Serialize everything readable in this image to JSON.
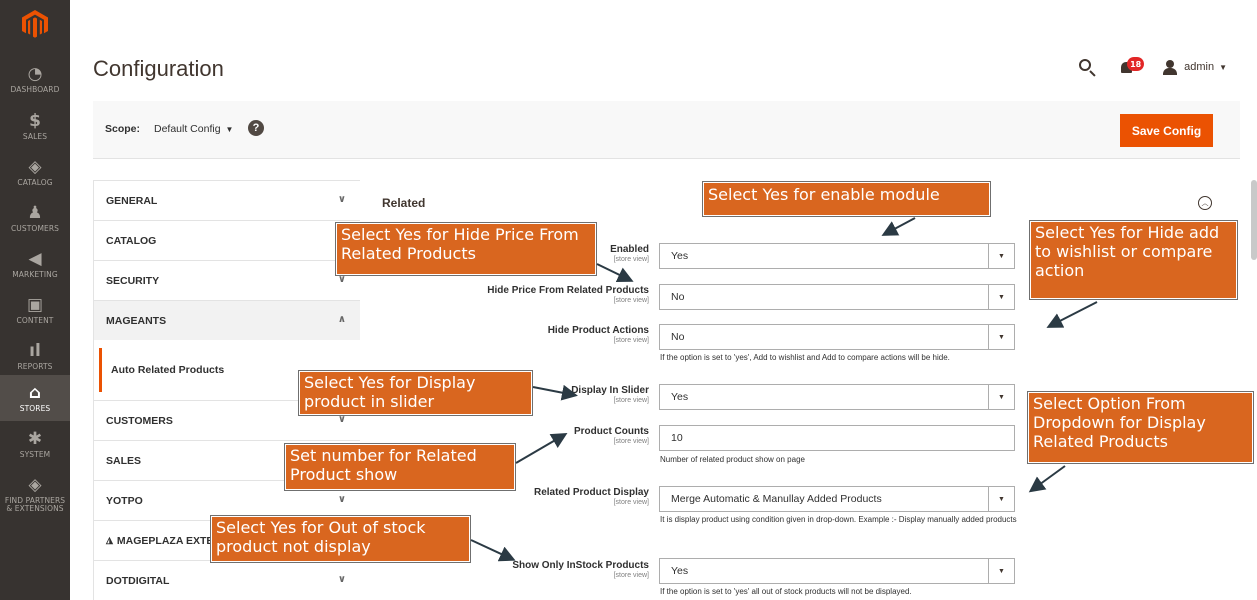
{
  "nav": {
    "items": [
      {
        "label": "DASHBOARD",
        "icon": "dashboard-icon",
        "glyph": "◔"
      },
      {
        "label": "SALES",
        "icon": "dollar-icon",
        "glyph": "$"
      },
      {
        "label": "CATALOG",
        "icon": "cube-icon",
        "glyph": "◈"
      },
      {
        "label": "CUSTOMERS",
        "icon": "person-icon",
        "glyph": "♟"
      },
      {
        "label": "MARKETING",
        "icon": "megaphone-icon",
        "glyph": "◀"
      },
      {
        "label": "CONTENT",
        "icon": "content-icon",
        "glyph": "▣"
      },
      {
        "label": "REPORTS",
        "icon": "bar-chart-icon",
        "glyph": "ıl"
      },
      {
        "label": "STORES",
        "icon": "store-icon",
        "glyph": "⌂"
      },
      {
        "label": "SYSTEM",
        "icon": "gear-icon",
        "glyph": "✱"
      },
      {
        "label": "FIND PARTNERS & EXTENSIONS",
        "icon": "partners-icon",
        "glyph": "◈"
      }
    ]
  },
  "header": {
    "title": "Configuration",
    "notification_count": "18",
    "user": "admin"
  },
  "scope": {
    "label": "Scope:",
    "value": "Default Config",
    "help": "?",
    "save_label": "Save Config"
  },
  "tabs": {
    "items": [
      "GENERAL",
      "CATALOG",
      "SECURITY",
      "MAGEANTS",
      "CUSTOMERS",
      "SALES",
      "YOTPO",
      "MAGEPLAZA EXTENSIONS",
      "DOTDIGITAL"
    ],
    "active_sub": "Auto Related Products"
  },
  "section": {
    "title": "Related",
    "fields": [
      {
        "label": "Enabled",
        "scope": "[store view]",
        "value": "Yes"
      },
      {
        "label": "Hide Price From Related Products",
        "scope": "[store view]",
        "value": "No"
      },
      {
        "label": "Hide Product Actions",
        "scope": "[store view]",
        "value": "No",
        "note": "If the option is set to 'yes', Add to wishlist and Add to compare actions will be hide."
      },
      {
        "label": "Display In Slider",
        "scope": "[store view]",
        "value": "Yes"
      },
      {
        "label": "Product Counts",
        "scope": "[store view]",
        "value": "10",
        "note": "Number of related product show on page"
      },
      {
        "label": "Related Product Display",
        "scope": "[store view]",
        "value": "Merge Automatic & Manullay Added Products",
        "note": "It is display product using condition given in drop-down. Example :- Display manually added products"
      },
      {
        "label": "Show Only InStock Products",
        "scope": "[store view]",
        "value": "Yes",
        "note": "If the option is set to 'yes' all out of stock products will not be displayed."
      }
    ]
  },
  "callouts": {
    "enable": "Select Yes for enable module",
    "hide_price": "Select Yes for Hide Price From Related Products",
    "hide_actions": "Select Yes for Hide add to wishlist or compare action",
    "slider": "Select Yes for Display product in slider",
    "count": "Set number for Related Product show",
    "display": "Select Option From Dropdown for Display Related Products",
    "stock": "Select Yes for Out of stock product not display"
  },
  "colors": {
    "nav_bg": "#373330",
    "accent": "#eb5202",
    "callout": "#d9661f"
  }
}
